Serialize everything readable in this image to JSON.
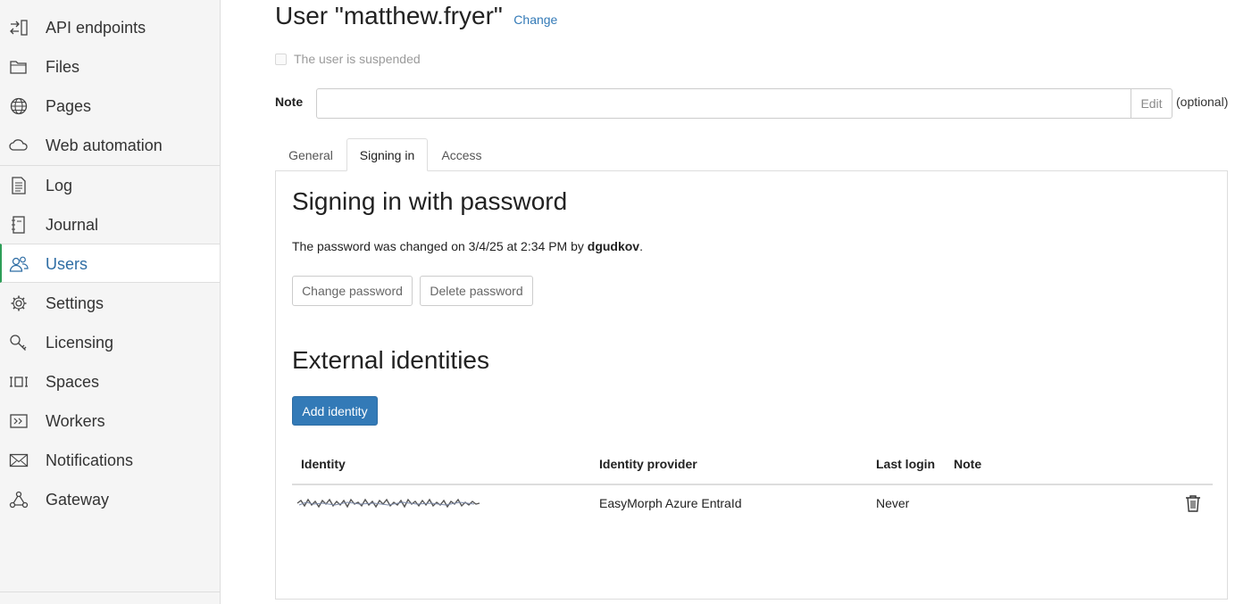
{
  "sidebar": {
    "items": [
      {
        "label": "API endpoints",
        "icon": "api-endpoints-icon"
      },
      {
        "label": "Files",
        "icon": "folder-icon"
      },
      {
        "label": "Pages",
        "icon": "globe-icon"
      },
      {
        "label": "Web automation",
        "icon": "cloud-icon"
      },
      {
        "label": "Log",
        "icon": "log-document-icon"
      },
      {
        "label": "Journal",
        "icon": "journal-icon"
      },
      {
        "label": "Users",
        "icon": "users-icon",
        "active": true
      },
      {
        "label": "Settings",
        "icon": "gear-icon"
      },
      {
        "label": "Licensing",
        "icon": "key-icon"
      },
      {
        "label": "Spaces",
        "icon": "spaces-icon"
      },
      {
        "label": "Workers",
        "icon": "workers-icon"
      },
      {
        "label": "Notifications",
        "icon": "envelope-icon"
      },
      {
        "label": "Gateway",
        "icon": "gateway-icon"
      }
    ]
  },
  "header": {
    "title": "User \"matthew.fryer\"",
    "change_label": "Change"
  },
  "suspended": {
    "label": "The user is suspended",
    "checked": false
  },
  "note": {
    "label": "Note",
    "value": "",
    "edit_label": "Edit",
    "optional_label": "(optional)"
  },
  "tabs": [
    {
      "label": "General"
    },
    {
      "label": "Signing in",
      "active": true
    },
    {
      "label": "Access"
    }
  ],
  "password_section": {
    "heading": "Signing in with password",
    "text_prefix": "The password was changed on 3/4/25 at 2:34 PM by ",
    "changed_by": "dgudkov",
    "text_suffix": ".",
    "change_button": "Change password",
    "delete_button": "Delete password"
  },
  "identities_section": {
    "heading": "External identities",
    "add_button": "Add identity",
    "columns": [
      "Identity",
      "Identity provider",
      "Last login",
      "Note"
    ],
    "rows": [
      {
        "identity": "",
        "provider": "EasyMorph Azure EntraId",
        "last_login": "Never",
        "note": ""
      }
    ]
  },
  "colors": {
    "accent": "#337ab7",
    "active_marker": "#2e9e58",
    "sidebar_bg": "#f5f5f5"
  }
}
